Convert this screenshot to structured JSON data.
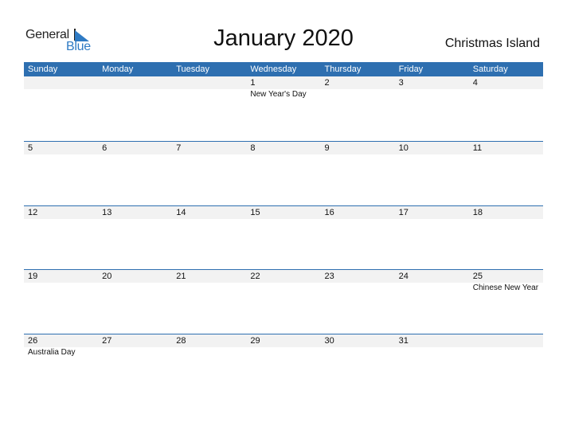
{
  "logo": {
    "word1": "General",
    "word2": "Blue"
  },
  "title": "January 2020",
  "region": "Christmas Island",
  "colors": {
    "header_bg": "#2e6fb0",
    "brand_blue": "#2f7bc4",
    "date_band": "#f2f2f2"
  },
  "weekdays": [
    "Sunday",
    "Monday",
    "Tuesday",
    "Wednesday",
    "Thursday",
    "Friday",
    "Saturday"
  ],
  "weeks": [
    [
      {
        "day": "",
        "event": ""
      },
      {
        "day": "",
        "event": ""
      },
      {
        "day": "",
        "event": ""
      },
      {
        "day": "1",
        "event": "New Year's Day"
      },
      {
        "day": "2",
        "event": ""
      },
      {
        "day": "3",
        "event": ""
      },
      {
        "day": "4",
        "event": ""
      }
    ],
    [
      {
        "day": "5",
        "event": ""
      },
      {
        "day": "6",
        "event": ""
      },
      {
        "day": "7",
        "event": ""
      },
      {
        "day": "8",
        "event": ""
      },
      {
        "day": "9",
        "event": ""
      },
      {
        "day": "10",
        "event": ""
      },
      {
        "day": "11",
        "event": ""
      }
    ],
    [
      {
        "day": "12",
        "event": ""
      },
      {
        "day": "13",
        "event": ""
      },
      {
        "day": "14",
        "event": ""
      },
      {
        "day": "15",
        "event": ""
      },
      {
        "day": "16",
        "event": ""
      },
      {
        "day": "17",
        "event": ""
      },
      {
        "day": "18",
        "event": ""
      }
    ],
    [
      {
        "day": "19",
        "event": ""
      },
      {
        "day": "20",
        "event": ""
      },
      {
        "day": "21",
        "event": ""
      },
      {
        "day": "22",
        "event": ""
      },
      {
        "day": "23",
        "event": ""
      },
      {
        "day": "24",
        "event": ""
      },
      {
        "day": "25",
        "event": "Chinese New Year"
      }
    ],
    [
      {
        "day": "26",
        "event": "Australia Day"
      },
      {
        "day": "27",
        "event": ""
      },
      {
        "day": "28",
        "event": ""
      },
      {
        "day": "29",
        "event": ""
      },
      {
        "day": "30",
        "event": ""
      },
      {
        "day": "31",
        "event": ""
      },
      {
        "day": "",
        "event": ""
      }
    ]
  ]
}
